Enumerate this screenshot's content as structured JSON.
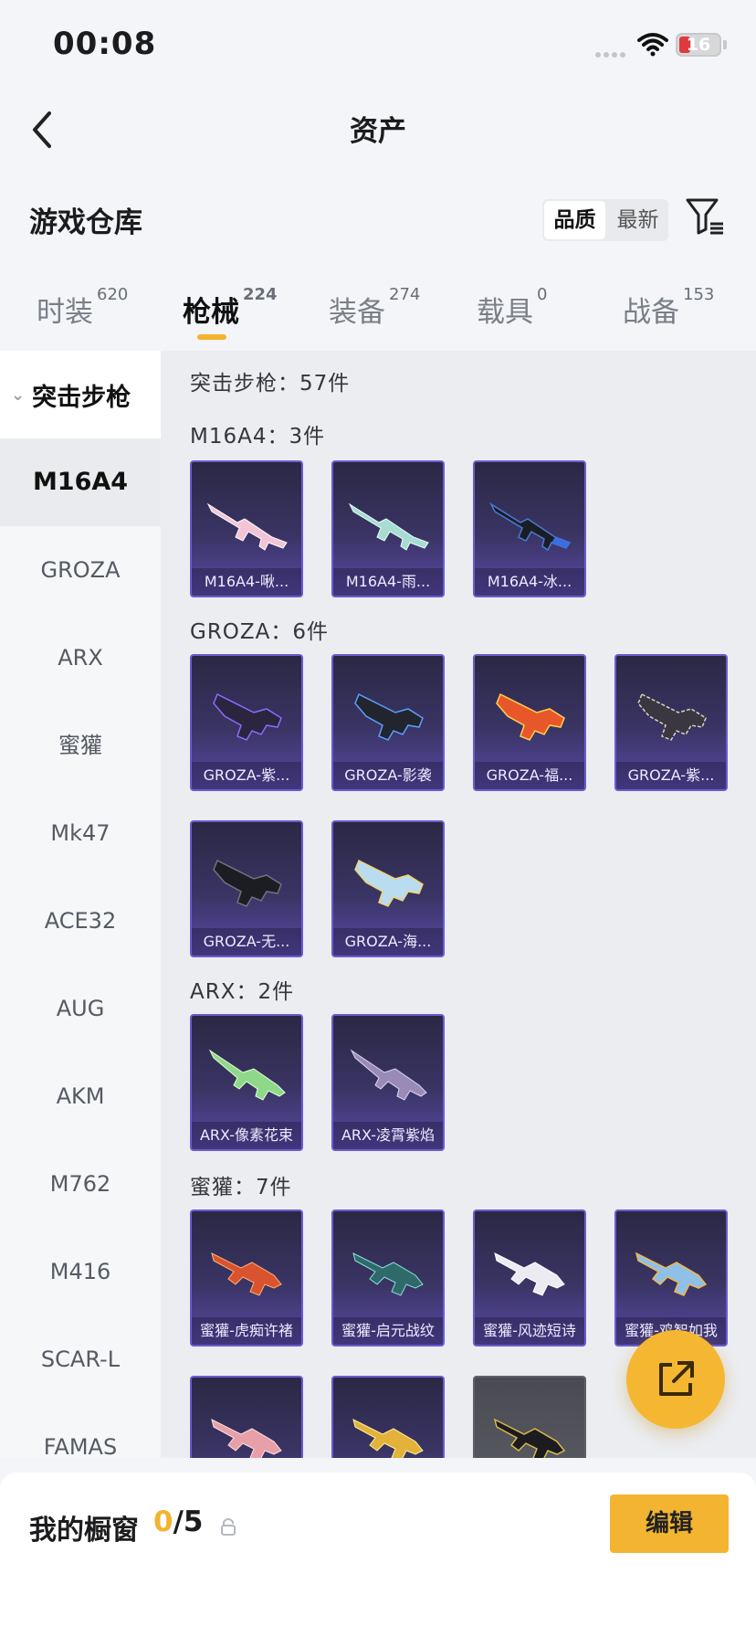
{
  "status": {
    "time": "00:08",
    "battery": "16"
  },
  "nav": {
    "title": "资产"
  },
  "section": {
    "title": "游戏仓库"
  },
  "sort": {
    "options": [
      "品质",
      "最新"
    ],
    "selected": "品质"
  },
  "tabs": [
    {
      "label": "时装",
      "count": "620"
    },
    {
      "label": "枪械",
      "count": "224"
    },
    {
      "label": "装备",
      "count": "274"
    },
    {
      "label": "载具",
      "count": "0"
    },
    {
      "label": "战备",
      "count": "153"
    }
  ],
  "sidebar": {
    "category": "突击步枪",
    "items": [
      "M16A4",
      "GROZA",
      "ARX",
      "蜜獾",
      "Mk47",
      "ACE32",
      "AUG",
      "AKM",
      "M762",
      "M416",
      "SCAR-L",
      "FAMAS"
    ],
    "selected": "M16A4"
  },
  "content": {
    "summary": "突击步枪：57件",
    "groups": [
      {
        "header": "M16A4：3件",
        "items": [
          "M16A4-啾...",
          "M16A4-雨...",
          "M16A4-冰..."
        ]
      },
      {
        "header": "GROZA：6件",
        "items": [
          "GROZA-紫...",
          "GROZA-影袭",
          "GROZA-福...",
          "GROZA-紫...",
          "GROZA-无...",
          "GROZA-海..."
        ]
      },
      {
        "header": "ARX：2件",
        "items": [
          "ARX-像素花束",
          "ARX-凌霄紫焰"
        ]
      },
      {
        "header": "蜜獾：7件",
        "items": [
          "蜜獾-虎痴许褚",
          "蜜獾-启元战纹",
          "蜜獾-风迹短诗",
          "蜜獾-鸡智如我",
          "",
          "",
          ""
        ]
      }
    ]
  },
  "bottom": {
    "label": "我的橱窗",
    "current": "0",
    "total": "/5",
    "edit": "编辑"
  },
  "colors": {
    "accent": "#f3b531",
    "card_border": "#6b5bd2"
  }
}
